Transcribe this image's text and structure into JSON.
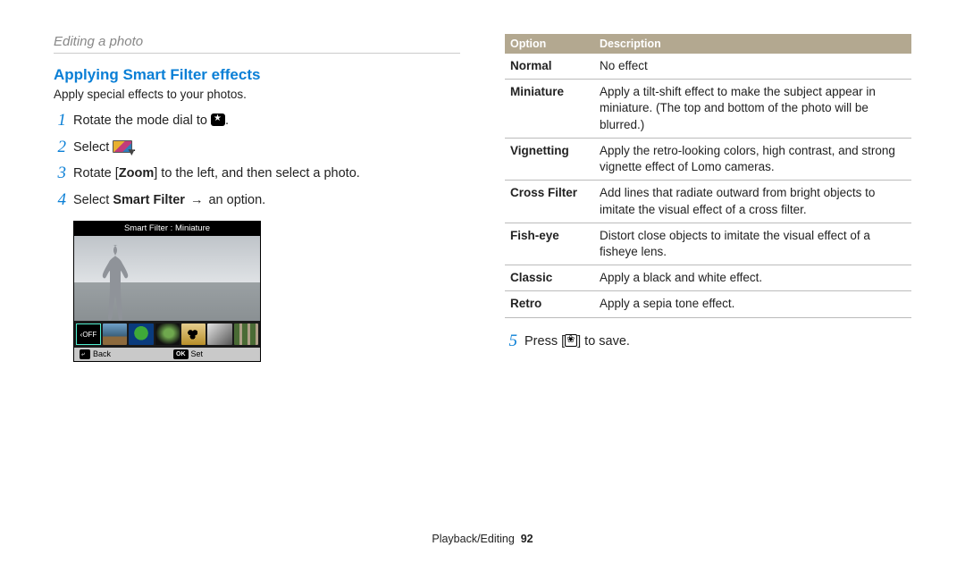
{
  "section_head": "Editing a photo",
  "heading": "Applying Smart Filter effects",
  "intro": "Apply special effects to your photos.",
  "steps": {
    "s1_pre": "Rotate the mode dial to ",
    "s1_post": ".",
    "s2_pre": "Select ",
    "s2_post": ".",
    "s3_html": "Rotate [<b>Zoom</b>] to the left, and then select a photo.",
    "s4_html": "Select <b>Smart Filter</b> <span class=\"arrow\">→</span> an option.",
    "s5_pre": "Press [",
    "s5_post": "] to save."
  },
  "screen": {
    "title": "Smart Filter : Miniature",
    "off": "‹OFF",
    "back_label": "Back",
    "set_label": "Set",
    "back_key": "⤶",
    "set_key": "OK"
  },
  "table": {
    "header_option": "Option",
    "header_desc": "Description",
    "rows": [
      {
        "opt": "Normal",
        "desc": "No effect"
      },
      {
        "opt": "Miniature",
        "desc": "Apply a tilt-shift effect to make the subject appear in miniature. (The top and bottom of the photo will be blurred.)"
      },
      {
        "opt": "Vignetting",
        "desc": "Apply the retro-looking colors, high contrast, and strong vignette effect of Lomo cameras."
      },
      {
        "opt": "Cross Filter",
        "desc": "Add lines that radiate outward from bright objects to imitate the visual effect of a cross filter."
      },
      {
        "opt": "Fish-eye",
        "desc": "Distort close objects to imitate the visual effect of a fisheye lens."
      },
      {
        "opt": "Classic",
        "desc": "Apply a black and white effect."
      },
      {
        "opt": "Retro",
        "desc": "Apply a sepia tone effect."
      }
    ]
  },
  "footer_section": "Playback/Editing",
  "footer_page": "92"
}
